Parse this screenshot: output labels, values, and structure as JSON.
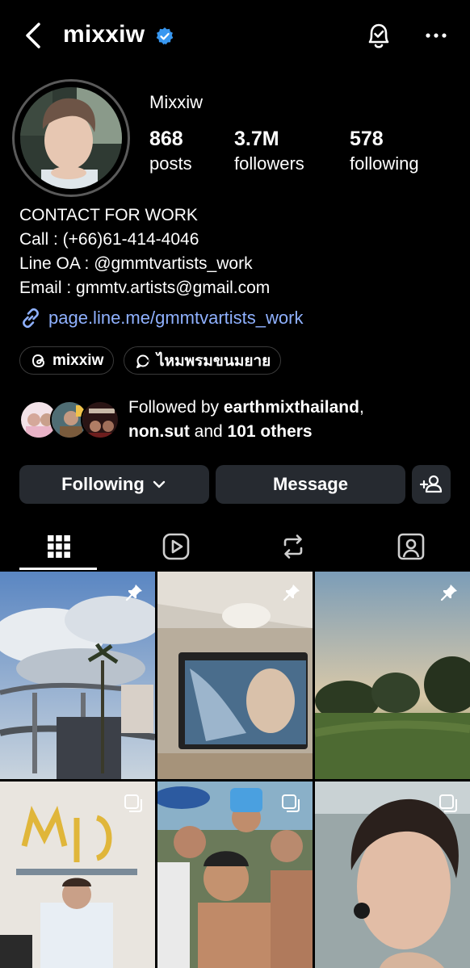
{
  "header": {
    "username": "mixxiw"
  },
  "profile": {
    "display_name": "Mixxiw",
    "stats": [
      {
        "value": "868",
        "label": "posts"
      },
      {
        "value": "3.7M",
        "label": "followers"
      },
      {
        "value": "578",
        "label": "following"
      }
    ],
    "bio_lines": [
      "CONTACT FOR WORK",
      "Call : (+66)61-414-4046",
      "Line OA : @gmmtvartists_work",
      "Email : gmmtv.artists@gmail.com"
    ],
    "link": "page.line.me/gmmtvartists_work",
    "chips": [
      {
        "label": "mixxiw",
        "icon": "threads-icon"
      },
      {
        "label": "ไหมพรมขนมยาย",
        "icon": "channel-icon"
      }
    ],
    "followed_by": {
      "prefix": "Followed by ",
      "user1": "earthmixthailand",
      "sep": ",",
      "user2": "non.sut",
      "and": " and ",
      "others": "101 others"
    }
  },
  "actions": {
    "following_label": "Following",
    "message_label": "Message"
  },
  "tabs": [
    "grid-icon",
    "reels-icon",
    "reposts-icon",
    "tagged-icon"
  ],
  "colors": {
    "background": "#000000",
    "button_bg": "#262a30",
    "link": "#8fb1ff",
    "verified": "#3897f0"
  }
}
